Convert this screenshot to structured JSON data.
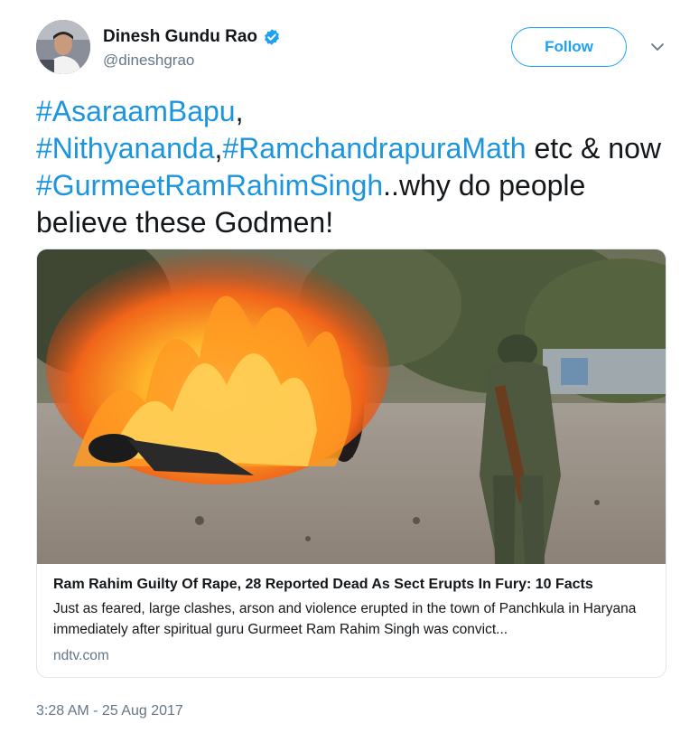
{
  "author": {
    "name": "Dinesh Gundu Rao",
    "handle": "@dineshgrao",
    "verified": true
  },
  "actions": {
    "follow_label": "Follow"
  },
  "tweet": {
    "segments": [
      {
        "text": "#AsaraamBapu",
        "hashtag": true
      },
      {
        "text": ",",
        "hashtag": false
      },
      {
        "text": "#Nithyananda",
        "hashtag": true
      },
      {
        "text": ",",
        "hashtag": false
      },
      {
        "text": "#RamchandrapuraMath",
        "hashtag": true
      },
      {
        "text": " etc & now ",
        "hashtag": false
      },
      {
        "text": "#GurmeetRamRahimSingh",
        "hashtag": true
      },
      {
        "text": "..why do people believe these Godmen!",
        "hashtag": false
      }
    ]
  },
  "card": {
    "title": "Ram Rahim Guilty Of Rape, 28 Reported Dead As Sect Erupts In Fury: 10 Facts",
    "description": "Just as feared, large clashes, arson and violence erupted in the town of Panchkula in Haryana immediately after spiritual guru Gurmeet Ram Rahim Singh was convict...",
    "domain": "ndtv.com"
  },
  "timestamp": "3:28 AM - 25 Aug 2017",
  "colors": {
    "accent": "#1da1f2",
    "hashtag": "#1b95e0",
    "secondary_text": "#657786"
  }
}
